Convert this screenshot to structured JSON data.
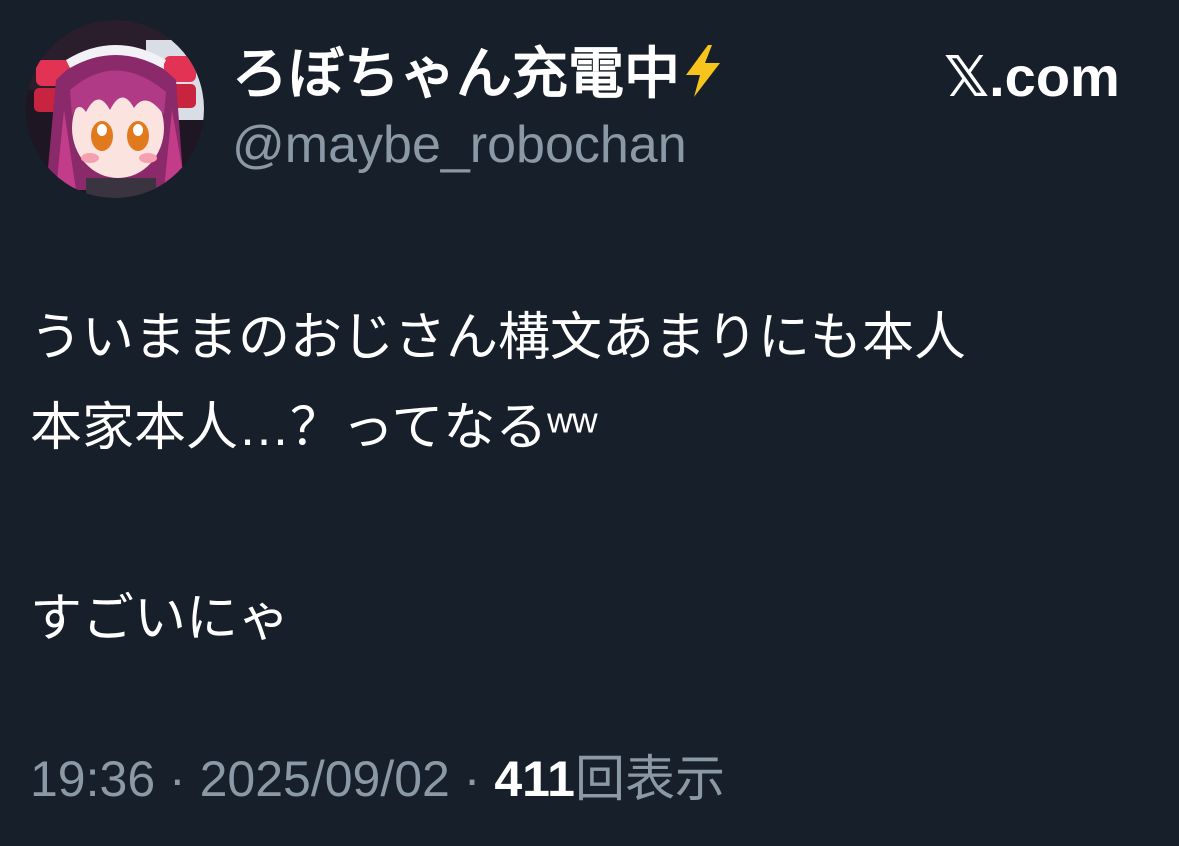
{
  "author": {
    "display_name": "ろぼちゃん充電中",
    "name_emoji": "⚡",
    "handle": "@maybe_robochan",
    "avatar_icon": "anime-girl-avatar"
  },
  "brand": {
    "x_glyph": "𝕏",
    "suffix": ".com"
  },
  "tweet": {
    "lines": [
      "ういままのおじさん構文あまりにも本人",
      "本家本人…？ってなるʷʷ",
      "すごいにゃ"
    ]
  },
  "meta": {
    "time": "19:36",
    "separator": "·",
    "date": "2025/09/02",
    "views_count": "411",
    "views_label": "回表示"
  },
  "colors": {
    "background": "#17202a",
    "text_primary": "#ffffff",
    "text_secondary": "#8b98a5",
    "bolt": "#f7c41d"
  }
}
